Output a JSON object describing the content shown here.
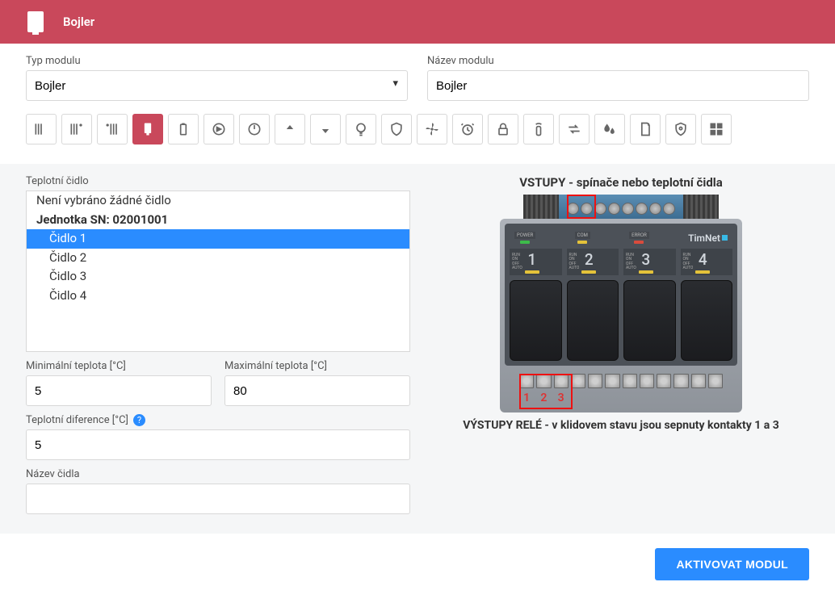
{
  "header": {
    "title": "Bojler"
  },
  "form": {
    "type_label": "Typ modulu",
    "type_value": "Bojler",
    "name_label": "Název modulu",
    "name_value": "Bojler"
  },
  "icons": [
    "bars1",
    "bars2",
    "bars3",
    "boiler",
    "battery",
    "pump",
    "power",
    "up",
    "down",
    "bulb",
    "shield1",
    "fan",
    "alarm",
    "lock",
    "remote",
    "swap",
    "drops",
    "sdcard",
    "shield2",
    "grid"
  ],
  "active_icon_index": 3,
  "sensor": {
    "label": "Teplotní čidlo",
    "list": {
      "none": "Není vybráno žádné čidlo",
      "unit": "Jednotka SN: 02001001",
      "items": [
        "Čidlo 1",
        "Čidlo 2",
        "Čidlo 3",
        "Čidlo 4"
      ],
      "selected_index": 0
    },
    "min_label": "Minimální teplota [°C]",
    "min_value": "5",
    "max_label": "Maximální teplota [°C]",
    "max_value": "80",
    "diff_label": "Teplotní diference [°C]",
    "diff_value": "5",
    "sensor_name_label": "Název čidla",
    "sensor_name_value": ""
  },
  "device": {
    "inputs_title": "VSTUPY - spínače nebo teplotní čidla",
    "outputs_title": "VÝSTUPY RELÉ - v klidovem stavu jsou sepnuty kontakty 1 a 3",
    "brand": "TimNet",
    "leds": {
      "power": "POWER",
      "com": "COM",
      "error": "ERROR"
    },
    "mode_text": "RUN\nON\nOFF\nAUTO",
    "channels": [
      "1",
      "2",
      "3",
      "4"
    ],
    "out_numbers": [
      "1",
      "2",
      "3"
    ]
  },
  "actions": {
    "activate": "AKTIVOVAT MODUL"
  }
}
